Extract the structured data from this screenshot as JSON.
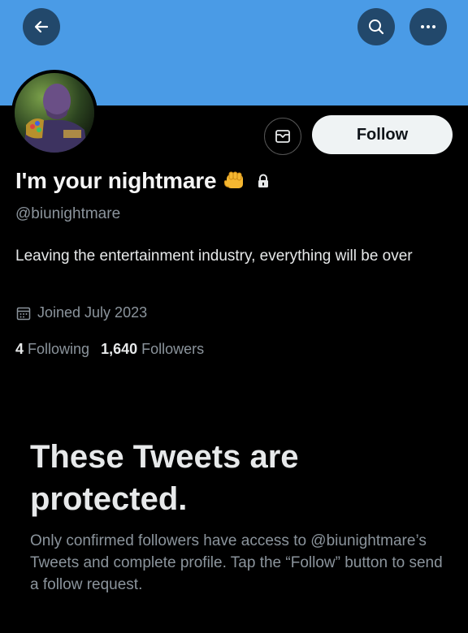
{
  "header": {
    "back_icon": "arrow-left-icon",
    "search_icon": "search-icon",
    "more_icon": "more-dots-icon"
  },
  "colors": {
    "banner": "#4a9be6",
    "background": "#000000",
    "primary_text": "#e7e9ea",
    "secondary_text": "#8b949c",
    "follow_button_bg": "#eff3f4"
  },
  "profile": {
    "avatar_icon": "avatar-image",
    "message_icon": "mail-icon",
    "follow_label": "Follow",
    "display_name": "I'm your nightmare",
    "name_emoji": "fist-emoji-icon",
    "protected_icon": "lock-icon",
    "handle": "@biunightmare",
    "bio": "Leaving the entertainment industry, everything will be over",
    "joined_icon": "calendar-icon",
    "joined": "Joined July 2023",
    "following_count": "4",
    "following_label": "Following",
    "followers_count": "1,640",
    "followers_label": "Followers"
  },
  "protected_notice": {
    "title": "These Tweets are protected.",
    "description": "Only confirmed followers have access to @biunightmare’s Tweets and complete profile. Tap the “Follow” button to send a follow request."
  }
}
